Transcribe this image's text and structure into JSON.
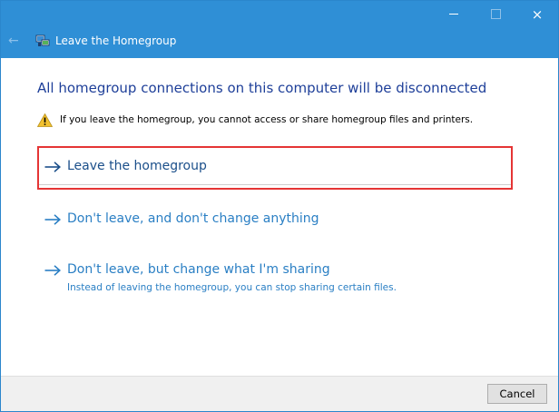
{
  "window": {
    "title": "Leave the Homegroup",
    "controls": {
      "minimize": "minimize",
      "maximize": "maximize",
      "close": "×"
    },
    "back_glyph": "←"
  },
  "content": {
    "heading": "All homegroup connections on this computer will be disconnected",
    "warning": "If you leave the homegroup, you cannot access or share homegroup files and printers.",
    "options": [
      {
        "label": "Leave the homegroup",
        "highlighted": true
      },
      {
        "label": "Don't leave, and don't change anything"
      },
      {
        "label": "Don't leave, but change what I'm sharing",
        "sub": "Instead of leaving the homegroup, you can stop sharing certain files."
      }
    ]
  },
  "footer": {
    "cancel_label": "Cancel"
  },
  "colors": {
    "titlebar": "#2f8fd6",
    "heading": "#1e3f99",
    "link": "#2a7fc4",
    "highlight_border": "#e53535"
  },
  "icons": {
    "title": "homegroup-icon",
    "warning": "warning-icon",
    "option_arrow": "arrow-right-icon"
  }
}
